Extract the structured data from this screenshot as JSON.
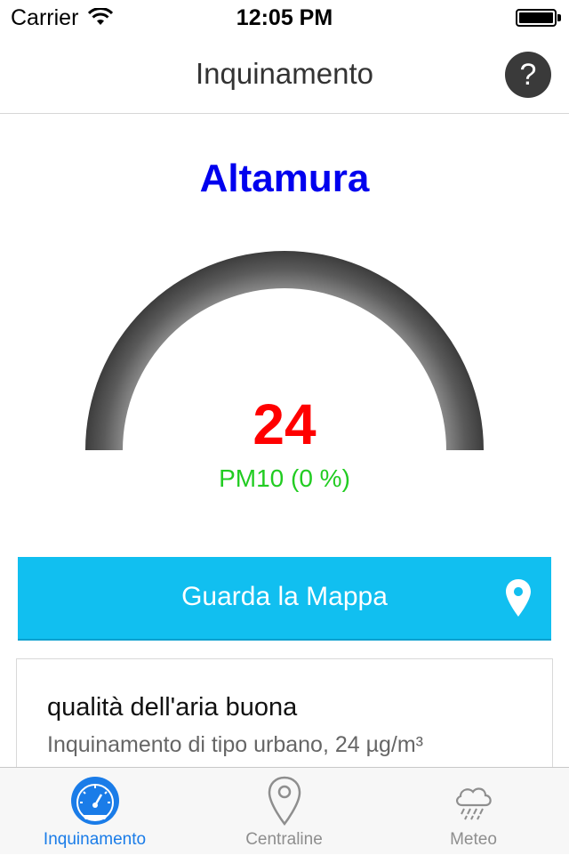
{
  "status": {
    "carrier": "Carrier",
    "time": "12:05 PM"
  },
  "nav": {
    "title": "Inquinamento",
    "help_label": "?"
  },
  "city": "Altamura",
  "gauge": {
    "value": "24",
    "pollutant_label": "PM10 (0 %)",
    "level_percent": 0,
    "value_color": "#ff0000",
    "label_color": "#22cc22"
  },
  "map_button": {
    "label": "Guarda la Mappa",
    "icon": "location-pin-icon"
  },
  "quality_card": {
    "title": "qualità dell'aria buona",
    "subtitle": "Inquinamento di tipo urbano, 24 µg/m³"
  },
  "tabs": [
    {
      "label": "Inquinamento",
      "icon": "speedometer-icon",
      "active": true
    },
    {
      "label": "Centraline",
      "icon": "location-pin-icon",
      "active": false
    },
    {
      "label": "Meteo",
      "icon": "rain-cloud-icon",
      "active": false
    }
  ],
  "colors": {
    "accent": "#11bff0",
    "tab_active": "#1a7ce8",
    "city": "#0000ee"
  }
}
